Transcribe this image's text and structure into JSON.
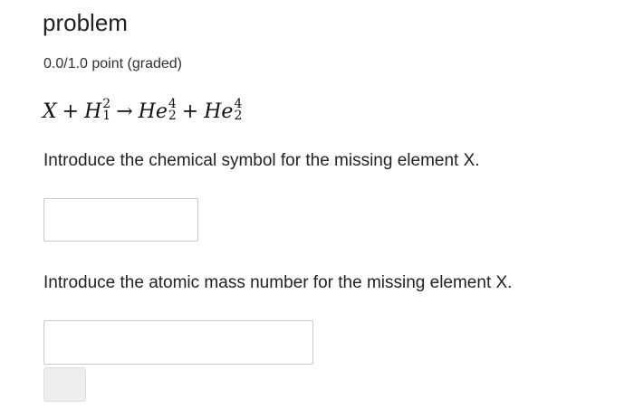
{
  "problem": {
    "title": "problem",
    "points": "0.0/1.0 point (graded)"
  },
  "equation": {
    "x": "X",
    "plus1": "+",
    "h_symbol": "H",
    "h_mass": "2",
    "h_atomic": "1",
    "arrow": "→",
    "he1_symbol": "He",
    "he1_mass": "4",
    "he1_atomic": "2",
    "plus2": "+",
    "he2_symbol": "He",
    "he2_mass": "4",
    "he2_atomic": "2"
  },
  "questions": [
    {
      "text": "Introduce the chemical symbol for the missing element X.",
      "value": ""
    },
    {
      "text": "Introduce the atomic mass number for the missing element X.",
      "value": ""
    }
  ],
  "colors": {
    "text": "#222222",
    "input_border": "#c8c8c8",
    "button_bg": "#eeeeee"
  }
}
